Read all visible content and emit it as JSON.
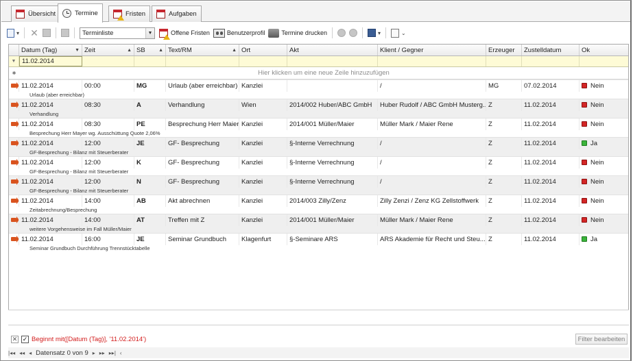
{
  "tabs": [
    {
      "label": "Übersicht",
      "active": false,
      "icon": "calendar-icon"
    },
    {
      "label": "Termine",
      "active": true,
      "icon": "clock-icon"
    },
    {
      "label": "Fristen",
      "active": false,
      "icon": "calendar-warning-icon"
    },
    {
      "label": "Aufgaben",
      "active": false,
      "icon": "calendar-check-icon"
    }
  ],
  "toolbar": {
    "view_select": "Terminliste",
    "offene_fristen": "Offene Fristen",
    "benutzerprofil": "Benutzerprofil",
    "termine_drucken": "Termine drucken"
  },
  "grid": {
    "columns": [
      "Datum (Tag)",
      "Zeit",
      "SB",
      "Text/RM",
      "Ort",
      "Akt",
      "Klient / Gegner",
      "Erzeuger",
      "Zustelldatum",
      "Ok"
    ],
    "filter_value": "11.02.2014",
    "new_row_hint": "Hier klicken um eine neue Zeile hinzuzufügen",
    "rows": [
      {
        "datum": "11.02.2014",
        "zeit": "00:00",
        "sb": "MG",
        "text": "Urlaub (aber erreichbar)",
        "ort": "Kanzlei",
        "akt": "",
        "klient": " /",
        "erzeuger": "MG",
        "zustell": "07.02.2014",
        "ok": "Nein",
        "note": "Urlaub (aber erreichbar)"
      },
      {
        "datum": "11.02.2014",
        "zeit": "08:30",
        "sb": "A",
        "text": "Verhandlung",
        "ort": "Wien",
        "akt": "2014/002 Huber/ABC GmbH",
        "klient": "Huber Rudolf / ABC GmbH Musterg...",
        "erzeuger": "Z",
        "zustell": "11.02.2014",
        "ok": "Nein",
        "note": "Verhandlung"
      },
      {
        "datum": "11.02.2014",
        "zeit": "08:30",
        "sb": "PE",
        "text": "Besprechung Herr Maier",
        "ort": "Kanzlei",
        "akt": "2014/001 Müller/Maier",
        "klient": "Müller Mark / Maier Rene",
        "erzeuger": "Z",
        "zustell": "11.02.2014",
        "ok": "Nein",
        "note": "Besprechung Herr Mayer wg. Ausschüttung Quote 2,06%"
      },
      {
        "datum": "11.02.2014",
        "zeit": "12:00",
        "sb": "JE",
        "text": "GF- Besprechung",
        "ort": "Kanzlei",
        "akt": "§-Interne Verrechnung",
        "klient": " /",
        "erzeuger": "Z",
        "zustell": "11.02.2014",
        "ok": "Ja",
        "note": "GF-Besprechung - Bilanz mit Steuerberater"
      },
      {
        "datum": "11.02.2014",
        "zeit": "12:00",
        "sb": "K",
        "text": "GF- Besprechung",
        "ort": "Kanzlei",
        "akt": "§-Interne Verrechnung",
        "klient": " /",
        "erzeuger": "Z",
        "zustell": "11.02.2014",
        "ok": "Nein",
        "note": "GF-Besprechung - Bilanz mit Steuerberater"
      },
      {
        "datum": "11.02.2014",
        "zeit": "12:00",
        "sb": "N",
        "text": "GF- Besprechung",
        "ort": "Kanzlei",
        "akt": "§-Interne Verrechnung",
        "klient": " /",
        "erzeuger": "Z",
        "zustell": "11.02.2014",
        "ok": "Nein",
        "note": "GF-Besprechung - Bilanz mit Steuerberater"
      },
      {
        "datum": "11.02.2014",
        "zeit": "14:00",
        "sb": "AB",
        "text": "Akt abrechnen",
        "ort": "Kanzlei",
        "akt": "2014/003 Zilly/Zenz",
        "klient": "Zilly Zenzi / Zenz KG Zellstoffwerk",
        "erzeuger": "Z",
        "zustell": "11.02.2014",
        "ok": "Nein",
        "note": "Zeitabrechnung/Besprechung"
      },
      {
        "datum": "11.02.2014",
        "zeit": "14:00",
        "sb": "AT",
        "text": "Treffen mit Z",
        "ort": "Kanzlei",
        "akt": "2014/001 Müller/Maier",
        "klient": "Müller Mark / Maier Rene",
        "erzeuger": "Z",
        "zustell": "11.02.2014",
        "ok": "Nein",
        "note": "weitere Vorgehensweise im Fall Müller/Maier"
      },
      {
        "datum": "11.02.2014",
        "zeit": "16:00",
        "sb": "JE",
        "text": "Seminar Grundbuch",
        "ort": "Klagenfurt",
        "akt": "§-Seminare ARS",
        "klient": "ARS Akademie für Recht und Steu...",
        "erzeuger": "Z",
        "zustell": "11.02.2014",
        "ok": "Ja",
        "note": "Seminar Grundbuch Durchführung Trennstücktabelle"
      }
    ]
  },
  "filterbar": {
    "expression": "Beginnt mit([Datum (Tag)], '11.02.2014')",
    "edit_button": "Filter bearbeiten"
  },
  "navigator": {
    "record_text": "Datensatz 0 von 9"
  },
  "colors": {
    "filter_row_bg": "#fefbd6",
    "alt_row_bg": "#efefef",
    "status_red": "#d32626",
    "status_green": "#3bb43b",
    "filter_text": "#d21c1c"
  }
}
